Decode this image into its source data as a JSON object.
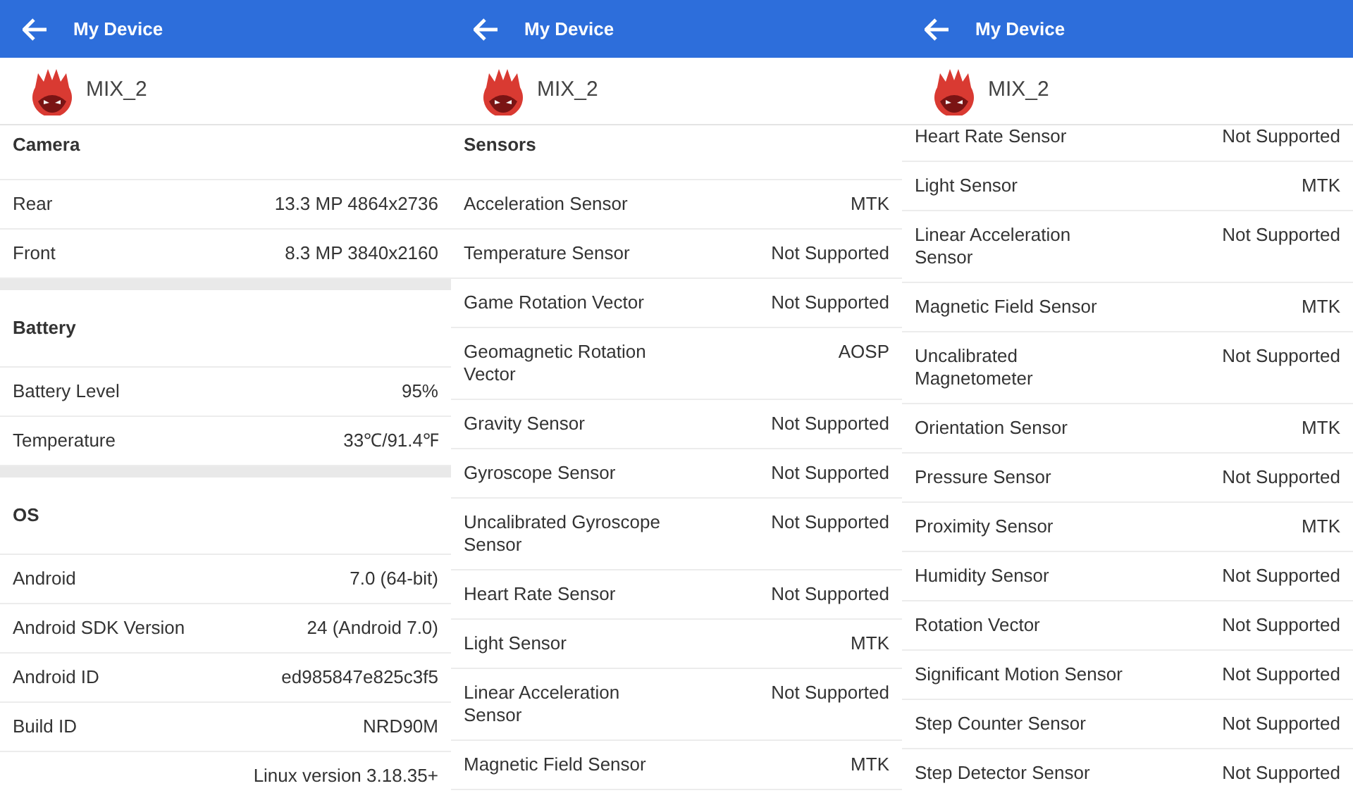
{
  "screens": [
    {
      "title": "My Device",
      "device": "MIX_2",
      "items": [
        {
          "kind": "header_cut",
          "label": "Camera"
        },
        {
          "kind": "row",
          "label": "Rear",
          "value": "13.3 MP 4864x2736"
        },
        {
          "kind": "row",
          "label": "Front",
          "value": "8.3 MP 3840x2160"
        },
        {
          "kind": "gap"
        },
        {
          "kind": "header",
          "label": "Battery"
        },
        {
          "kind": "row",
          "label": "Battery Level",
          "value": "95%"
        },
        {
          "kind": "row",
          "label": "Temperature",
          "value": "33℃/91.4℉"
        },
        {
          "kind": "gap"
        },
        {
          "kind": "header",
          "label": "OS"
        },
        {
          "kind": "row",
          "label": "Android",
          "value": "7.0 (64-bit)"
        },
        {
          "kind": "row",
          "label": "Android SDK Version",
          "value": "24 (Android 7.0)"
        },
        {
          "kind": "row",
          "label": "Android ID",
          "value": "ed985847e825c3f5"
        },
        {
          "kind": "row",
          "label": "Build ID",
          "value": "NRD90M"
        },
        {
          "kind": "row",
          "value": "Linux version 3.18.35+"
        }
      ]
    },
    {
      "title": "My Device",
      "device": "MIX_2",
      "items": [
        {
          "kind": "header_cut",
          "label": "Sensors"
        },
        {
          "kind": "row",
          "label": "Acceleration Sensor",
          "value": "MTK"
        },
        {
          "kind": "row",
          "label": "Temperature Sensor",
          "value": "Not Supported"
        },
        {
          "kind": "row",
          "label": "Game Rotation Vector",
          "value": "Not Supported"
        },
        {
          "kind": "row",
          "label": "Geomagnetic Rotation\nVector",
          "value": "AOSP"
        },
        {
          "kind": "row",
          "label": "Gravity Sensor",
          "value": "Not Supported"
        },
        {
          "kind": "row",
          "label": "Gyroscope Sensor",
          "value": "Not Supported"
        },
        {
          "kind": "row",
          "label": "Uncalibrated Gyroscope\nSensor",
          "value": "Not Supported"
        },
        {
          "kind": "row",
          "label": "Heart Rate Sensor",
          "value": "Not Supported"
        },
        {
          "kind": "row",
          "label": "Light Sensor",
          "value": "MTK"
        },
        {
          "kind": "row",
          "label": "Linear Acceleration\nSensor",
          "value": "Not Supported"
        },
        {
          "kind": "row",
          "label": "Magnetic Field Sensor",
          "value": "MTK"
        }
      ]
    },
    {
      "title": "My Device",
      "device": "MIX_2",
      "items": [
        {
          "kind": "row_cut",
          "label": "Heart Rate Sensor",
          "value": "Not Supported"
        },
        {
          "kind": "row",
          "label": "Light Sensor",
          "value": "MTK"
        },
        {
          "kind": "row",
          "label": "Linear Acceleration\nSensor",
          "value": "Not Supported"
        },
        {
          "kind": "row",
          "label": "Magnetic Field Sensor",
          "value": "MTK"
        },
        {
          "kind": "row",
          "label": "Uncalibrated\nMagnetometer",
          "value": "Not Supported"
        },
        {
          "kind": "row",
          "label": "Orientation Sensor",
          "value": "MTK"
        },
        {
          "kind": "row",
          "label": "Pressure Sensor",
          "value": "Not Supported"
        },
        {
          "kind": "row",
          "label": "Proximity Sensor",
          "value": "MTK"
        },
        {
          "kind": "row",
          "label": "Humidity Sensor",
          "value": "Not Supported"
        },
        {
          "kind": "row",
          "label": "Rotation Vector",
          "value": "Not Supported"
        },
        {
          "kind": "row",
          "label": "Significant Motion Sensor",
          "value": "Not Supported"
        },
        {
          "kind": "row",
          "label": "Step Counter Sensor",
          "value": "Not Supported"
        },
        {
          "kind": "row",
          "label": "Step Detector Sensor",
          "value": "Not Supported"
        }
      ]
    }
  ]
}
